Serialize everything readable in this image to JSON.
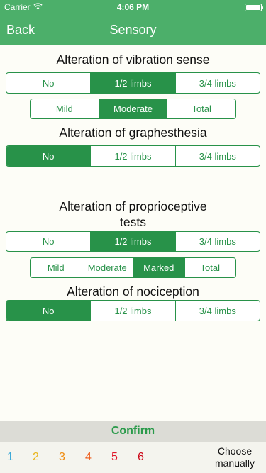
{
  "status": {
    "carrier": "Carrier",
    "time": "4:06 PM"
  },
  "nav": {
    "back": "Back",
    "title": "Sensory"
  },
  "q1": {
    "title": "Alteration of vibration sense",
    "limbs": [
      "No",
      "1/2 limbs",
      "3/4 limbs"
    ],
    "limbs_selected": "1/2 limbs",
    "severity": [
      "Mild",
      "Moderate",
      "Total"
    ],
    "severity_selected": "Moderate"
  },
  "q2": {
    "title": "Alteration of graphesthesia",
    "limbs": [
      "No",
      "1/2 limbs",
      "3/4 limbs"
    ],
    "limbs_selected": "No"
  },
  "q3": {
    "title_line1": "Alteration of proprioceptive",
    "title_line2": "tests",
    "limbs": [
      "No",
      "1/2 limbs",
      "3/4 limbs"
    ],
    "limbs_selected": "1/2 limbs",
    "severity": [
      "Mild",
      "Moderate",
      "Marked",
      "Total"
    ],
    "severity_selected": "Marked"
  },
  "q4": {
    "title": "Alteration of nociception",
    "limbs": [
      "No",
      "1/2 limbs",
      "3/4 limbs"
    ],
    "limbs_selected": "No"
  },
  "bottom": {
    "confirm": "Confirm",
    "numbers": [
      {
        "label": "1",
        "color": "#3aa8d8"
      },
      {
        "label": "2",
        "color": "#e8b418"
      },
      {
        "label": "3",
        "color": "#f08c10"
      },
      {
        "label": "4",
        "color": "#ee5a18"
      },
      {
        "label": "5",
        "color": "#e0182a"
      },
      {
        "label": "6",
        "color": "#cc0a1a"
      }
    ],
    "choose_line1": "Choose",
    "choose_line2": "manually"
  },
  "colors": {
    "accent": "#289249",
    "navbar": "#4caf6a",
    "confirm_text": "#2a9a4a"
  }
}
